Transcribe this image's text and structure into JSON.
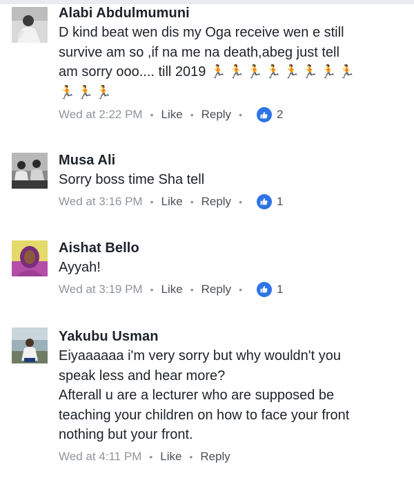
{
  "comments": [
    {
      "author": "Alabi Abdulmumuni",
      "text_lines": [
        "D kind beat wen dis my Oga receive wen e  still",
        "survive am so ,if na me na death,abeg just tell",
        "am sorry ooo.... till 2019"
      ],
      "emoji_icon": "person-running-icon",
      "emoji_counts": {
        "line3": 8,
        "line4": 3
      },
      "time": "Wed at 2:22 PM",
      "like_label": "Like",
      "reply_label": "Reply",
      "reaction_count": "2"
    },
    {
      "author": "Musa Ali",
      "text_lines": [
        "Sorry boss time Sha tell"
      ],
      "time": "Wed at 3:16 PM",
      "like_label": "Like",
      "reply_label": "Reply",
      "reaction_count": "1"
    },
    {
      "author": "Aishat Bello",
      "text_lines": [
        "Ayyah!"
      ],
      "time": "Wed at 3:19 PM",
      "like_label": "Like",
      "reply_label": "Reply",
      "reaction_count": "1"
    },
    {
      "author": "Yakubu Usman",
      "text_lines": [
        "Eiyaaaaaa i'm very sorry but why wouldn't you",
        "speak less and hear more?",
        "Afterall u are a lecturer who are supposed be",
        "teaching your children on how to face your front",
        "nothing but your front."
      ],
      "time": "Wed at 4:11 PM",
      "like_label": "Like",
      "reply_label": "Reply"
    }
  ],
  "colors": {
    "name": "#1d2129",
    "meta": "#90949c",
    "like_badge": "#2f74e6"
  }
}
